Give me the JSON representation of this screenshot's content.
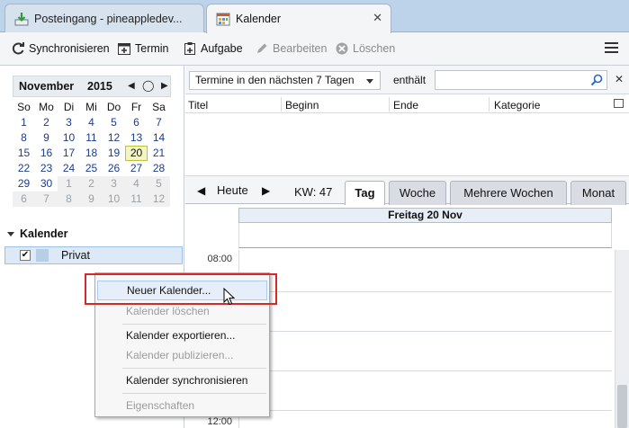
{
  "tabs": [
    {
      "label": "Posteingang - pineappledev..."
    },
    {
      "label": "Kalender"
    }
  ],
  "toolbar": {
    "sync": "Synchronisieren",
    "event": "Termin",
    "task": "Aufgabe",
    "edit": "Bearbeiten",
    "delete": "Löschen"
  },
  "minimonth": {
    "month": "November",
    "year": "2015",
    "days_of_week": [
      "So",
      "Mo",
      "Di",
      "Mi",
      "Do",
      "Fr",
      "Sa"
    ],
    "weeks": [
      [
        "1",
        "2",
        "3",
        "4",
        "5",
        "6",
        "7"
      ],
      [
        "8",
        "9",
        "10",
        "11",
        "12",
        "13",
        "14"
      ],
      [
        "15",
        "16",
        "17",
        "18",
        "19",
        "20",
        "21"
      ],
      [
        "22",
        "23",
        "24",
        "25",
        "26",
        "27",
        "28"
      ],
      [
        "29",
        "30",
        "1",
        "2",
        "3",
        "4",
        "5"
      ],
      [
        "6",
        "7",
        "8",
        "9",
        "10",
        "11",
        "12"
      ]
    ],
    "today": "20"
  },
  "calendars": {
    "heading": "Kalender",
    "items": [
      {
        "name": "Privat"
      }
    ]
  },
  "filter": {
    "selected": "Termine in den nächsten 7 Tagen",
    "contains_label": "enthält",
    "search_value": ""
  },
  "columns": [
    "Titel",
    "Beginn",
    "Ende",
    "Kategorie"
  ],
  "viewbar": {
    "today": "Heute",
    "week_label": "KW: 47",
    "views": [
      "Tag",
      "Woche",
      "Mehrere Wochen",
      "Monat"
    ],
    "selected_view": "Tag"
  },
  "dayview": {
    "date_header": "Freitag 20 Nov",
    "hours": [
      "08:00",
      "12:00"
    ]
  },
  "context_menu": {
    "items": [
      {
        "label": "Neuer Kalender...",
        "enabled": true
      },
      {
        "label": "Kalender löschen",
        "enabled": false
      },
      {
        "label": "Kalender exportieren...",
        "enabled": true
      },
      {
        "label": "Kalender publizieren...",
        "enabled": false
      },
      {
        "label": "Kalender synchronisieren",
        "enabled": true
      },
      {
        "label": "Eigenschaften",
        "enabled": false
      }
    ]
  },
  "colors": {
    "accent_highlight": "#d42a2a",
    "today_cell": "#f3f6c0",
    "selection": "#dde9f7"
  }
}
